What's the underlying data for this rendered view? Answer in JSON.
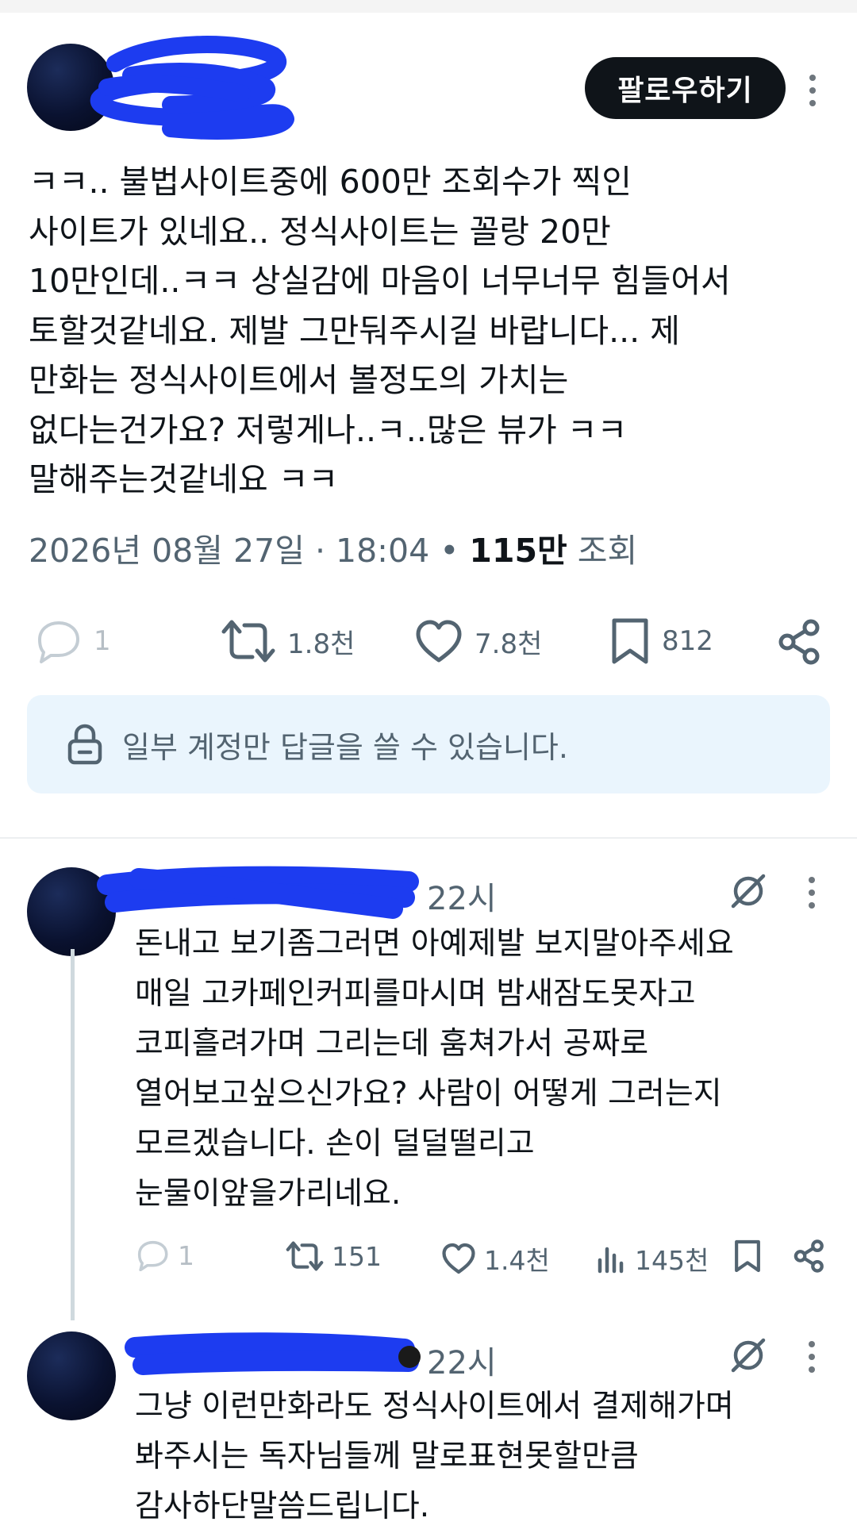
{
  "post": {
    "follow_label": "팔로우하기",
    "text": "ㅋㅋ.. 불법사이트중에 600만 조회수가 찍인\n사이트가 있네요.. 정식사이트는 꼴랑 20만\n10만인데..ㅋㅋ 상실감에 마음이 너무너무 힘들어서\n토할것같네요. 제발 그만둬주시길 바랍니다... 제\n만화는 정식사이트에서 볼정도의 가치는\n없다는건가요? 저렇게나..ㅋ..많은 뷰가 ㅋㅋ\n말해주는것같네요 ㅋㅋ",
    "date": "2026년 08월 27일 · 18:04 • ",
    "views_count": "115만",
    "views_unit": " 조회",
    "actions": {
      "replies": "1",
      "reposts": "1.8천",
      "likes": "7.8천",
      "bookmarks": "812"
    },
    "icons": [
      "reply-icon",
      "repost-icon",
      "like-icon",
      "bookmark-icon",
      "share-icon",
      "more-icon"
    ]
  },
  "notice": {
    "text": "일부 계정만 답글을 쓸 수 있습니다.",
    "icon": "lock-icon"
  },
  "replies": [
    {
      "time": "22시",
      "text": "돈내고 보기좀그러면 아예제발 보지말아주세요\n매일 고카페인커피를마시며 밤새잠도못자고\n코피흘려가며 그리는데 훔쳐가서 공짜로\n열어보고싶으신가요? 사람이 어떻게 그러는지\n모르겠습니다. 손이 덜덜떨리고\n눈물이앞을가리네요.",
      "actions": {
        "replies": "1",
        "reposts": "151",
        "likes": "1.4천",
        "views": "145천"
      }
    },
    {
      "time": "22시",
      "text": "그냥 이런만화라도 정식사이트에서 결제해가며\n봐주시는 독자님들께 말로표현못할만큼\n감사하단말씀드립니다."
    }
  ],
  "colors": {
    "text_primary": "#0f1419",
    "text_secondary": "#536471",
    "notice_bg": "#eaf5fd",
    "redaction_blue": "#1d3cf0"
  }
}
